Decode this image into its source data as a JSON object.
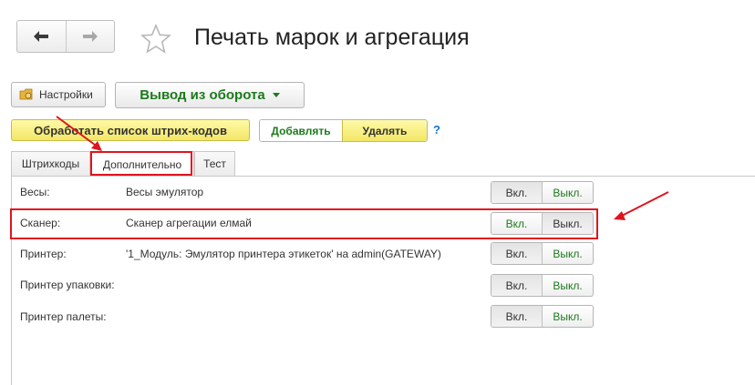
{
  "window": {
    "title": "Печать марок и агрегация"
  },
  "icons": {
    "back": "arrow-left-icon",
    "forward": "arrow-right-icon",
    "favorite": "star-icon",
    "settings": "folder-gear-icon",
    "dropdown": "caret-down-icon"
  },
  "toolbar": {
    "settings_label": "Настройки",
    "output_label": "Вывод из оборота",
    "process_label": "Обработать список штрих-кодов",
    "add_label": "Добавлять",
    "delete_label": "Удалять",
    "help_label": "?"
  },
  "tabs": [
    {
      "label": "Штрихкоды"
    },
    {
      "label": "Дополнительно"
    },
    {
      "label": "Тест"
    }
  ],
  "devices": [
    {
      "label": "Весы:",
      "value": "Весы эмулятор",
      "on": "Вкл.",
      "off": "Выкл."
    },
    {
      "label": "Сканер:",
      "value": "Сканер агрегации елмай",
      "on": "Вкл.",
      "off": "Выкл."
    },
    {
      "label": "Принтер:",
      "value": "'1_Модуль: Эмулятор принтера этикеток' на admin(GATEWAY)",
      "on": "Вкл.",
      "off": "Выкл."
    },
    {
      "label": "Принтер упаковки:",
      "value": "",
      "on": "Вкл.",
      "off": "Выкл."
    },
    {
      "label": "Принтер палеты:",
      "value": "",
      "on": "Вкл.",
      "off": "Выкл."
    }
  ],
  "colors": {
    "accent_green": "#1c7a1c",
    "highlight_yellow": "#f2e765",
    "annotation_red": "#e0141e",
    "link_blue": "#1a73c9"
  }
}
